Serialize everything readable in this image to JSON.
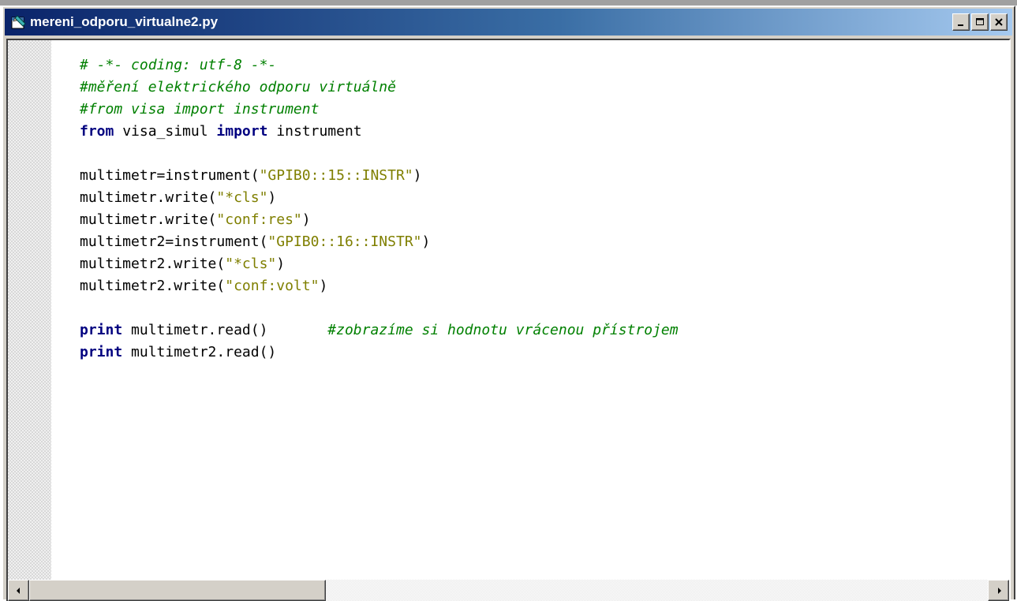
{
  "window": {
    "title": "mereni_odporu_virtualne2.py",
    "icon": "python-file-icon"
  },
  "controls": {
    "minimize": "minimize-icon",
    "maximize": "maximize-icon",
    "close": "close-icon"
  },
  "code": {
    "lines": [
      [
        {
          "t": "com",
          "v": "# -*- coding: utf-8 -*-"
        }
      ],
      [
        {
          "t": "com",
          "v": "#měření elektrického odporu virtuálně"
        }
      ],
      [
        {
          "t": "com",
          "v": "#from visa import instrument"
        }
      ],
      [
        {
          "t": "kw",
          "v": "from"
        },
        {
          "t": "txt",
          "v": " visa_simul "
        },
        {
          "t": "kw",
          "v": "import"
        },
        {
          "t": "txt",
          "v": " instrument"
        }
      ],
      [],
      [
        {
          "t": "txt",
          "v": "multimetr=instrument("
        },
        {
          "t": "str",
          "v": "\"GPIB0::15::INSTR\""
        },
        {
          "t": "txt",
          "v": ")"
        }
      ],
      [
        {
          "t": "txt",
          "v": "multimetr.write("
        },
        {
          "t": "str",
          "v": "\"*cls\""
        },
        {
          "t": "txt",
          "v": ")"
        }
      ],
      [
        {
          "t": "txt",
          "v": "multimetr.write("
        },
        {
          "t": "str",
          "v": "\"conf:res\""
        },
        {
          "t": "txt",
          "v": ")"
        }
      ],
      [
        {
          "t": "txt",
          "v": "multimetr2=instrument("
        },
        {
          "t": "str",
          "v": "\"GPIB0::16::INSTR\""
        },
        {
          "t": "txt",
          "v": ")"
        }
      ],
      [
        {
          "t": "txt",
          "v": "multimetr2.write("
        },
        {
          "t": "str",
          "v": "\"*cls\""
        },
        {
          "t": "txt",
          "v": ")"
        }
      ],
      [
        {
          "t": "txt",
          "v": "multimetr2.write("
        },
        {
          "t": "str",
          "v": "\"conf:volt\""
        },
        {
          "t": "txt",
          "v": ")"
        }
      ],
      [],
      [
        {
          "t": "kw",
          "v": "print"
        },
        {
          "t": "txt",
          "v": " multimetr.read()       "
        },
        {
          "t": "com",
          "v": "#zobrazíme si hodnotu vrácenou přístrojem"
        }
      ],
      [
        {
          "t": "kw",
          "v": "print"
        },
        {
          "t": "txt",
          "v": " multimetr2.read()"
        }
      ]
    ]
  },
  "colors": {
    "keyword": "#000080",
    "string": "#7f7f00",
    "comment": "#008000",
    "titlebar_start": "#0a246a",
    "titlebar_end": "#a6caf0"
  }
}
